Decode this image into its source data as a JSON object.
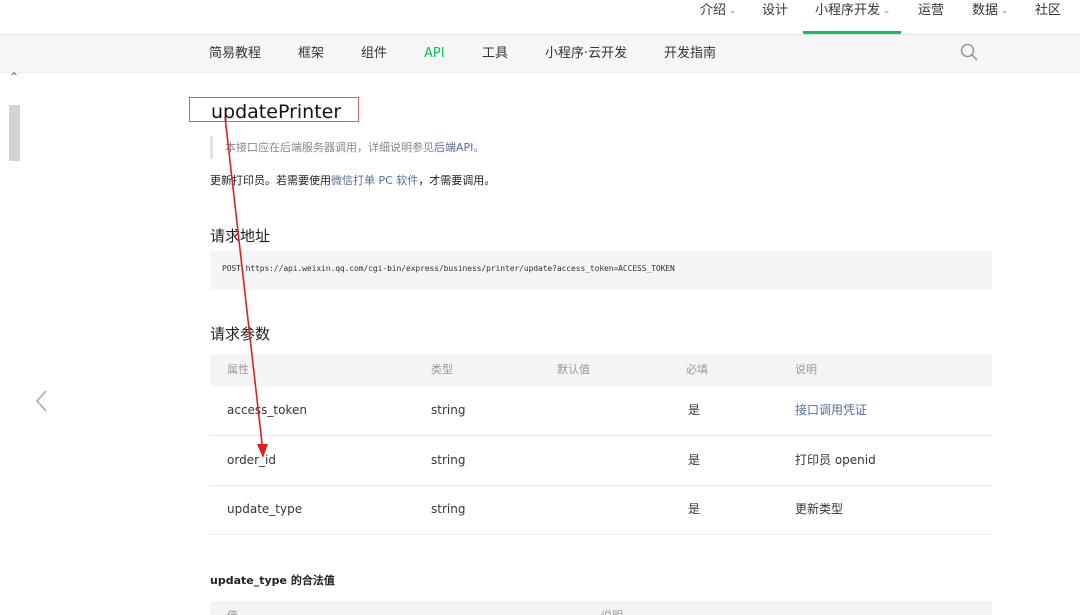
{
  "topnav": {
    "items": [
      {
        "label": "介绍",
        "dropdown": true
      },
      {
        "label": "设计",
        "dropdown": false
      },
      {
        "label": "小程序开发",
        "dropdown": true,
        "active": true
      },
      {
        "label": "运营",
        "dropdown": false
      },
      {
        "label": "数据",
        "dropdown": true
      },
      {
        "label": "社区",
        "dropdown": false
      }
    ],
    "accent": "#07c160"
  },
  "subnav": {
    "items": [
      {
        "label": "简易教程"
      },
      {
        "label": "框架"
      },
      {
        "label": "组件"
      },
      {
        "label": "API",
        "current": true
      },
      {
        "label": "工具"
      },
      {
        "label": "小程序·云开发"
      },
      {
        "label": "开发指南"
      }
    ],
    "search_icon": "search-icon"
  },
  "page": {
    "title": "updatePrinter",
    "note_prefix": "本接口应在后端服务器调用，详细说明参见",
    "note_link": "后端API",
    "note_suffix": "。",
    "desc_prefix": "更新打印员。若需要使用",
    "desc_link": "微信打单 PC 软件",
    "desc_suffix": "，才需要调用。",
    "request_url_heading": "请求地址",
    "request_url": "POST https://api.weixin.qq.com/cgi-bin/express/business/printer/update?access_token=ACCESS_TOKEN",
    "params_heading": "请求参数",
    "params_table": {
      "headers": [
        "属性",
        "类型",
        "默认值",
        "必填",
        "说明"
      ],
      "rows": [
        {
          "name": "access_token",
          "type": "string",
          "default": "",
          "required": "是",
          "desc": "接口调用凭证",
          "desc_is_link": true
        },
        {
          "name": "order_id",
          "type": "string",
          "default": "",
          "required": "是",
          "desc": "打印员 openid",
          "desc_is_link": false
        },
        {
          "name": "update_type",
          "type": "string",
          "default": "",
          "required": "是",
          "desc": "更新类型",
          "desc_is_link": false
        }
      ]
    },
    "enum_heading_code": "update_type",
    "enum_heading_text": " 的合法值",
    "enum_table_headers": [
      "值",
      "说明"
    ]
  },
  "colors": {
    "link": "#576b95",
    "annotation": "#e02020"
  }
}
